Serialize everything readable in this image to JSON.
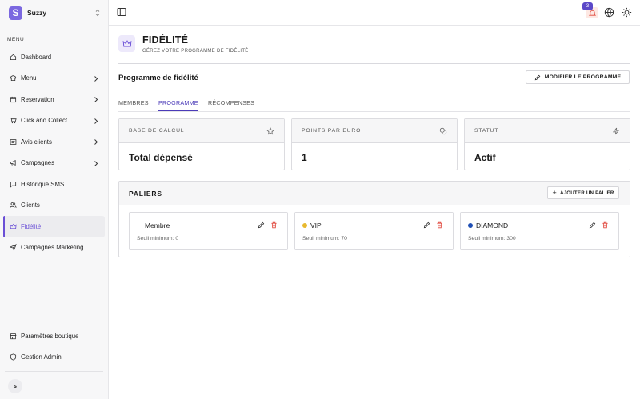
{
  "sidebar": {
    "brand_letter": "S",
    "brand_name": "Suzzy",
    "menu_title": "MENU",
    "items": [
      {
        "label": "Dashboard",
        "icon": "home-icon",
        "chevron": false
      },
      {
        "label": "Menu",
        "icon": "chef-hat-icon",
        "chevron": true
      },
      {
        "label": "Reservation",
        "icon": "calendar-icon",
        "chevron": true
      },
      {
        "label": "Click and Collect",
        "icon": "shopping-cart-icon",
        "chevron": true
      },
      {
        "label": "Avis clients",
        "icon": "reviews-icon",
        "chevron": true
      },
      {
        "label": "Campagnes",
        "icon": "megaphone-icon",
        "chevron": true
      },
      {
        "label": "Historique SMS",
        "icon": "message-icon",
        "chevron": false
      },
      {
        "label": "Clients",
        "icon": "users-icon",
        "chevron": false
      },
      {
        "label": "Fidélité",
        "icon": "crown-icon",
        "chevron": false,
        "active": true
      },
      {
        "label": "Campagnes Marketing",
        "icon": "send-icon",
        "chevron": false
      }
    ],
    "bottom_items": [
      {
        "label": "Paramètres boutique",
        "icon": "store-icon"
      },
      {
        "label": "Gestion Admin",
        "icon": "shield-icon"
      }
    ],
    "avatar_initial": "s"
  },
  "topbar": {
    "notification_count": "3"
  },
  "header": {
    "title": "FIDÉLITÉ",
    "subtitle": "GÉREZ VOTRE PROGRAMME DE FIDÉLITÉ"
  },
  "program": {
    "title": "Programme de fidélité",
    "modify_label": "MODIFIER LE PROGRAMME"
  },
  "tabs": [
    "MEMBRES",
    "PROGRAMME",
    "RÉCOMPENSES"
  ],
  "active_tab": "PROGRAMME",
  "cards": [
    {
      "label": "BASE DE CALCUL",
      "value": "Total dépensé",
      "icon": "star-icon"
    },
    {
      "label": "POINTS PAR EURO",
      "value": "1",
      "icon": "coins-icon"
    },
    {
      "label": "STATUT",
      "value": "Actif",
      "icon": "zap-icon"
    }
  ],
  "tiers": {
    "title": "PALIERS",
    "add_label": "AJOUTER UN PALIER",
    "items": [
      {
        "name": "Membre",
        "min": "Seuil minimum: 0",
        "color": "#ffffff"
      },
      {
        "name": "VIP",
        "min": "Seuil minimum: 70",
        "color": "#e8b92f"
      },
      {
        "name": "DIAMOND",
        "min": "Seuil minimum: 300",
        "color": "#1f4fb5"
      }
    ]
  },
  "colors": {
    "accent": "#6a4fd6",
    "danger": "#e0453a"
  }
}
